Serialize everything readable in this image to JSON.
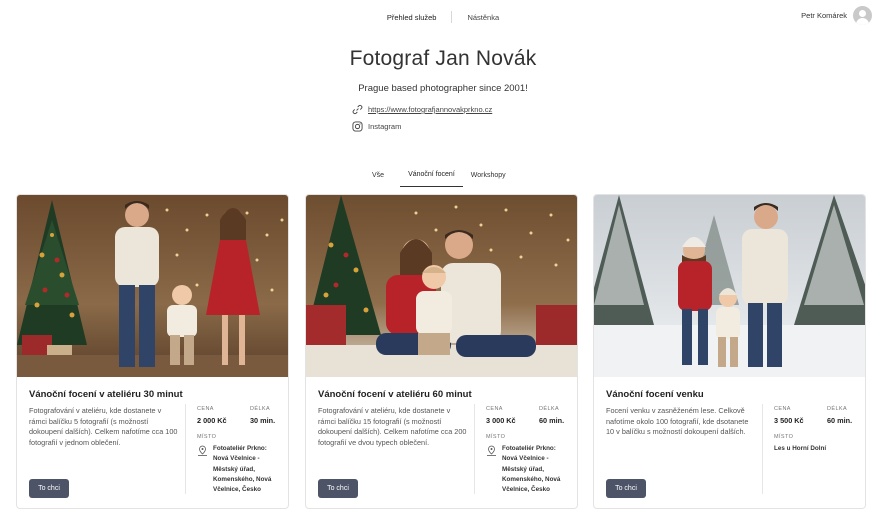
{
  "nav": {
    "links": [
      "Přehled služeb",
      "Nástěnka"
    ],
    "user_name": "Petr Komárek"
  },
  "hero": {
    "title": "Fotograf Jan Novák",
    "subtitle": "Prague based photographer since 2001!",
    "website": "https://www.fotografjannovakprkno.cz",
    "instagram": "Instagram"
  },
  "tabs": [
    "Vše",
    "Vánoční focení",
    "Workshopy"
  ],
  "active_tab": "Vánoční focení",
  "labels": {
    "price": "CENA",
    "duration": "DÉLKA",
    "place": "MÍSTO",
    "cta": "To chci"
  },
  "cards": [
    {
      "title": "Vánoční focení v ateliéru 30 minut",
      "description": "Fotografování v ateliéru, kde dostanete v rámci balíčku 5 fotografií (s možností dokoupení dalších). Celkem nafotíme cca 100 fotografií v jednom oblečení.",
      "price": "2 000 Kč",
      "duration": "30 min.",
      "place": "Fotoateliér Prkno: Nová Včelnice - Městský úřad, Komenského, Nová Včelnice, Česko"
    },
    {
      "title": "Vánoční focení v ateliéru 60 minut",
      "description": "Fotografování v ateliéru, kde dostanete v rámci balíčku 15 fotografií (s možností dokoupení dalších). Celkem nafotíme cca 200 fotografií ve dvou typech oblečení.",
      "price": "3 000 Kč",
      "duration": "60 min.",
      "place": "Fotoateliér Prkno: Nová Včelnice - Městský úřad, Komenského, Nová Včelnice, Česko"
    },
    {
      "title": "Vánoční focení venku",
      "description": "Focení venku v zasněženém lese. Celkově nafotíme okolo 100 fotografií, kde dsotanete 10 v balíčku s možností dokoupení dalších.",
      "price": "3 500 Kč",
      "duration": "60 min.",
      "place": "Les u Horní Dolní"
    }
  ],
  "colors": {
    "button": "#4d5468",
    "border": "#e3e3e3"
  }
}
